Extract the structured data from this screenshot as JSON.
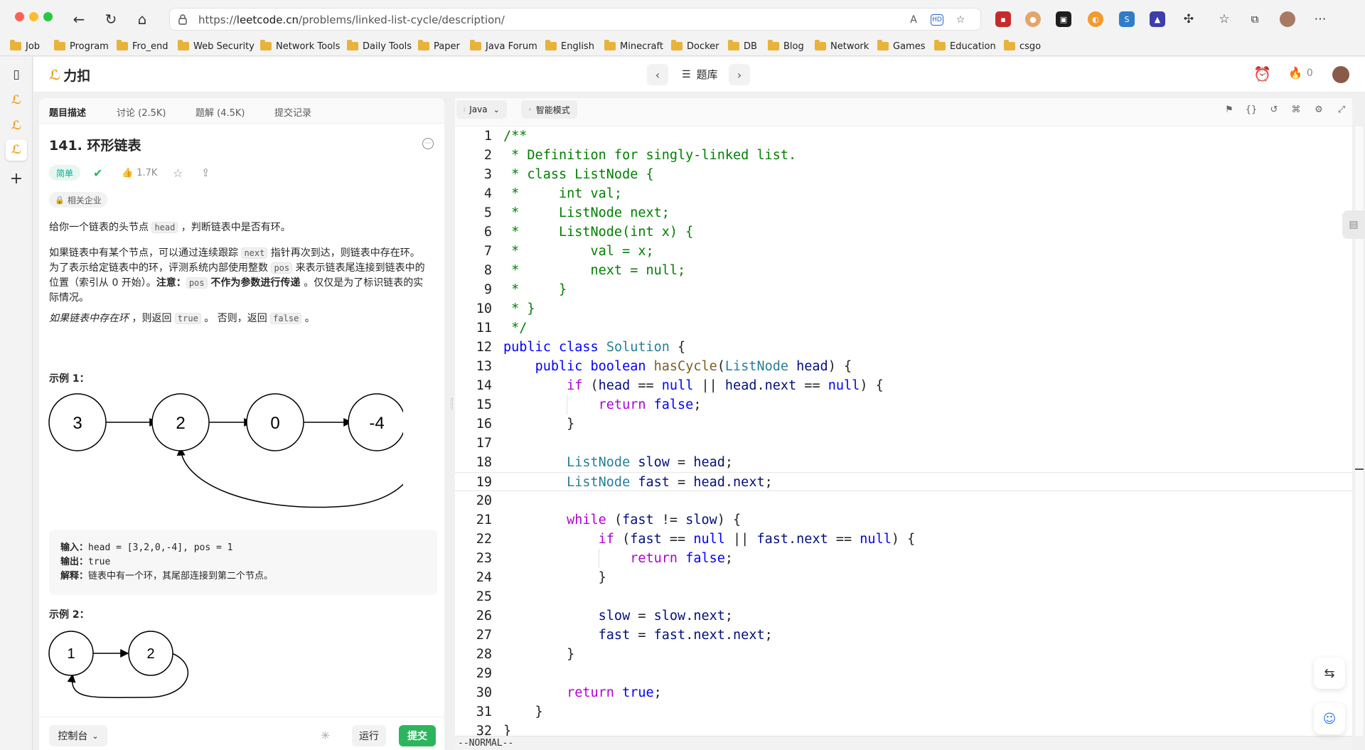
{
  "browser": {
    "url_prefix": "https://",
    "url_host": "leetcode.cn",
    "url_path": "/problems/linked-list-cycle/description/"
  },
  "bookmarks": [
    "Job",
    "Program",
    "Fro_end",
    "Web Security",
    "Network Tools",
    "Daily Tools",
    "Paper",
    "Java Forum",
    "English",
    "Minecraft",
    "Docker",
    "DB",
    "Blog",
    "Network",
    "Games",
    "Education",
    "csgo"
  ],
  "header": {
    "logo_text": "力扣",
    "problem_list_label": "题库",
    "streak_count": "0"
  },
  "left": {
    "tabs": [
      "题目描述",
      "讨论 (2.5K)",
      "题解 (4.5K)",
      "提交记录"
    ],
    "title": "141. 环形链表",
    "difficulty": "简单",
    "likes": "1.7K",
    "company_tag": "相关企业",
    "desc1_a": "给你一个链表的头节点 ",
    "desc1_code": "head",
    "desc1_b": " ，判断链表中是否有环。",
    "desc2_a": "如果链表中有某个节点，可以通过连续跟踪 ",
    "desc2_code1": "next",
    "desc2_b": " 指针再次到达，则链表中存在环。 为了表示给定链表中的环，评测系统内部使用整数 ",
    "desc2_code2": "pos",
    "desc2_c": " 来表示链表尾连接到链表中的位置（索引从 0 开始）。",
    "desc2_note": "注意：",
    "desc2_code3": "pos",
    "desc2_bold": " 不作为参数进行传递 ",
    "desc2_d": "。仅仅是为了标识链表的实际情况。",
    "desc3_italic": "如果链表中存在环",
    "desc3_a": " ，则返回 ",
    "desc3_code1": "true",
    "desc3_b": " 。 否则，返回 ",
    "desc3_code2": "false",
    "desc3_c": " 。",
    "example1_title": "示例 1：",
    "example1_nodes": [
      "3",
      "2",
      "0",
      "-4"
    ],
    "example1_input_label": "输入：",
    "example1_input": "head = [3,2,0,-4], pos = 1",
    "example1_output_label": "输出：",
    "example1_output": "true",
    "example1_explain_label": "解释：",
    "example1_explain": "链表中有一个环，其尾部连接到第二个节点。",
    "example2_title": "示例 2：",
    "example2_nodes": [
      "1",
      "2"
    ],
    "console_label": "控制台",
    "run_label": "运行",
    "submit_label": "提交"
  },
  "editor": {
    "language": "Java",
    "mode": "智能模式",
    "status": "--NORMAL--",
    "cursor_line": 19,
    "lines": [
      [
        [
          "c-cm",
          "/**"
        ]
      ],
      [
        [
          "c-cm",
          " * Definition for singly-linked list."
        ]
      ],
      [
        [
          "c-cm",
          " * class ListNode {"
        ]
      ],
      [
        [
          "c-cm",
          " *     int val;"
        ]
      ],
      [
        [
          "c-cm",
          " *     ListNode next;"
        ]
      ],
      [
        [
          "c-cm",
          " *     ListNode(int x) {"
        ]
      ],
      [
        [
          "c-cm",
          " *         val = x;"
        ]
      ],
      [
        [
          "c-cm",
          " *         next = null;"
        ]
      ],
      [
        [
          "c-cm",
          " *     }"
        ]
      ],
      [
        [
          "c-cm",
          " * }"
        ]
      ],
      [
        [
          "c-cm",
          " */"
        ]
      ],
      [
        [
          "c-kw",
          "public"
        ],
        [
          "",
          " "
        ],
        [
          "c-kw",
          "class"
        ],
        [
          "",
          " "
        ],
        [
          "c-ty",
          "Solution"
        ],
        [
          "",
          " {"
        ]
      ],
      [
        [
          "",
          "    "
        ],
        [
          "c-kw",
          "public"
        ],
        [
          "",
          " "
        ],
        [
          "c-kw",
          "boolean"
        ],
        [
          "",
          " "
        ],
        [
          "c-fn",
          "hasCycle"
        ],
        [
          "",
          "("
        ],
        [
          "c-ty",
          "ListNode"
        ],
        [
          "",
          " "
        ],
        [
          "c-var",
          "head"
        ],
        [
          "",
          ") {"
        ]
      ],
      [
        [
          "",
          "        "
        ],
        [
          "c-flow",
          "if"
        ],
        [
          "",
          " ("
        ],
        [
          "c-var",
          "head"
        ],
        [
          "",
          " == "
        ],
        [
          "c-kw",
          "null"
        ],
        [
          "",
          " || "
        ],
        [
          "c-var",
          "head"
        ],
        [
          "",
          "."
        ],
        [
          "c-var",
          "next"
        ],
        [
          "",
          " == "
        ],
        [
          "c-kw",
          "null"
        ],
        [
          "",
          ") {"
        ]
      ],
      [
        [
          "",
          "            "
        ],
        [
          "c-flow",
          "return"
        ],
        [
          "",
          " "
        ],
        [
          "c-kw",
          "false"
        ],
        [
          "",
          ";"
        ]
      ],
      [
        [
          "",
          "        }"
        ]
      ],
      [
        [
          "",
          ""
        ]
      ],
      [
        [
          "",
          "        "
        ],
        [
          "c-ty",
          "ListNode"
        ],
        [
          "",
          " "
        ],
        [
          "c-var",
          "slow"
        ],
        [
          "",
          " = "
        ],
        [
          "c-var",
          "head"
        ],
        [
          "",
          ";"
        ]
      ],
      [
        [
          "",
          "        "
        ],
        [
          "c-ty",
          "ListNode"
        ],
        [
          "",
          " "
        ],
        [
          "c-var",
          "fast"
        ],
        [
          "",
          " = "
        ],
        [
          "c-var",
          "head"
        ],
        [
          "",
          "."
        ],
        [
          "c-var",
          "next"
        ],
        [
          "",
          ";"
        ]
      ],
      [
        [
          "",
          ""
        ]
      ],
      [
        [
          "",
          "        "
        ],
        [
          "c-flow",
          "while"
        ],
        [
          "",
          " ("
        ],
        [
          "c-var",
          "fast"
        ],
        [
          "",
          " != "
        ],
        [
          "c-var",
          "slow"
        ],
        [
          "",
          ") {"
        ]
      ],
      [
        [
          "",
          "            "
        ],
        [
          "c-flow",
          "if"
        ],
        [
          "",
          " ("
        ],
        [
          "c-var",
          "fast"
        ],
        [
          "",
          " == "
        ],
        [
          "c-kw",
          "null"
        ],
        [
          "",
          " || "
        ],
        [
          "c-var",
          "fast"
        ],
        [
          "",
          "."
        ],
        [
          "c-var",
          "next"
        ],
        [
          "",
          " == "
        ],
        [
          "c-kw",
          "null"
        ],
        [
          "",
          ") {"
        ]
      ],
      [
        [
          "",
          "                "
        ],
        [
          "c-flow",
          "return"
        ],
        [
          "",
          " "
        ],
        [
          "c-kw",
          "false"
        ],
        [
          "",
          ";"
        ]
      ],
      [
        [
          "",
          "            }"
        ]
      ],
      [
        [
          "",
          ""
        ]
      ],
      [
        [
          "",
          "            "
        ],
        [
          "c-var",
          "slow"
        ],
        [
          "",
          " = "
        ],
        [
          "c-var",
          "slow"
        ],
        [
          "",
          "."
        ],
        [
          "c-var",
          "next"
        ],
        [
          "",
          ";"
        ]
      ],
      [
        [
          "",
          "            "
        ],
        [
          "c-var",
          "fast"
        ],
        [
          "",
          " = "
        ],
        [
          "c-var",
          "fast"
        ],
        [
          "",
          "."
        ],
        [
          "c-var",
          "next"
        ],
        [
          "",
          "."
        ],
        [
          "c-var",
          "next"
        ],
        [
          "",
          ";"
        ]
      ],
      [
        [
          "",
          "        }"
        ]
      ],
      [
        [
          "",
          ""
        ]
      ],
      [
        [
          "",
          "        "
        ],
        [
          "c-flow",
          "return"
        ],
        [
          "",
          " "
        ],
        [
          "c-kw",
          "true"
        ],
        [
          "",
          ";"
        ]
      ],
      [
        [
          "",
          "    }"
        ]
      ],
      [
        [
          "",
          "}"
        ]
      ]
    ]
  }
}
